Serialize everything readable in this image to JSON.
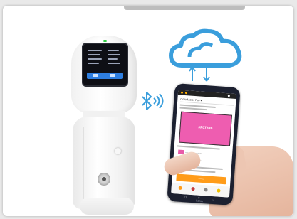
{
  "scene": {
    "description_items": [
      "spectrophotometer",
      "bluetooth-signal",
      "cloud-sync",
      "smartphone-app",
      "hand"
    ]
  },
  "colors": {
    "cloud": "#3a9edc",
    "bluetooth": "#3a9edc",
    "swatch": "#ee5db0",
    "mini_swatch": "#e85aa8",
    "button": "#ff9c1a",
    "phone_status_accent": "#ffae00"
  },
  "icons": {
    "bluetooth": "bluetooth-icon",
    "cloud": "cloud-icon",
    "upload": "arrow-up-icon",
    "download": "arrow-down-icon"
  },
  "phone": {
    "app_title": "ColorMeter Pro ▾",
    "swatch_code": "#F0739E",
    "button_label": "——",
    "brand": "honor",
    "mini_items": [
      "————————",
      "————————"
    ]
  }
}
